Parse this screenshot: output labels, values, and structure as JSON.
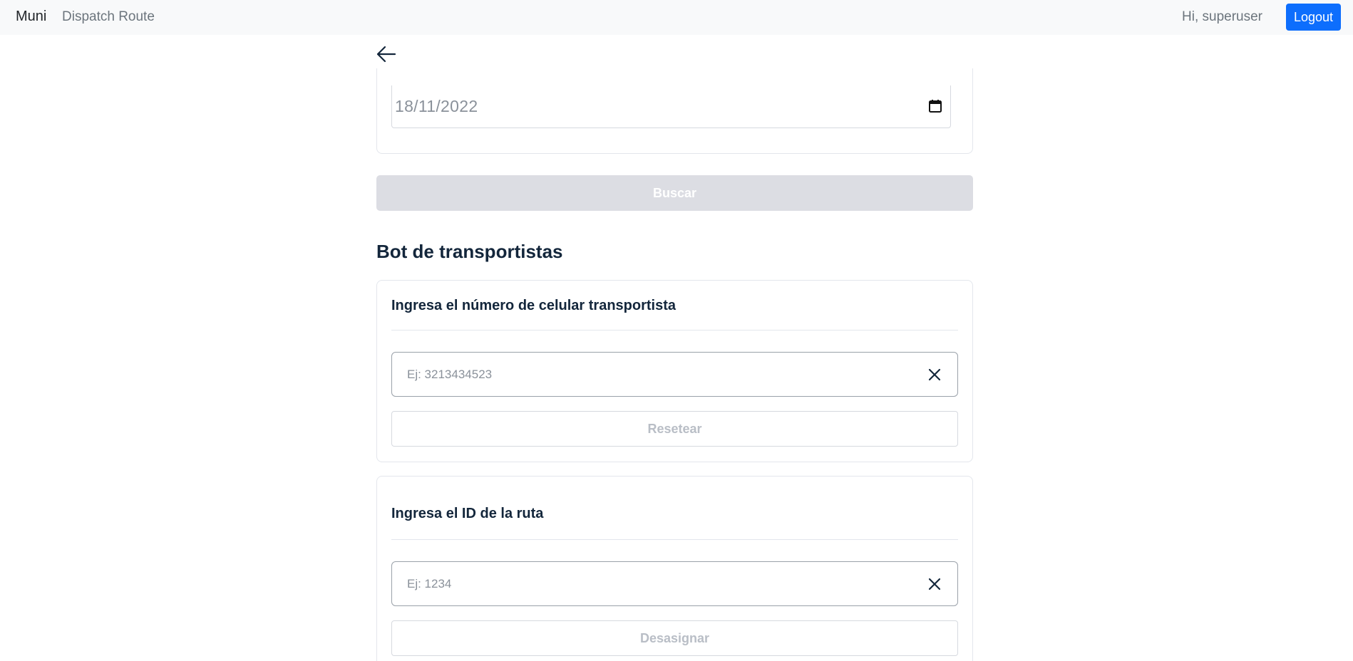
{
  "navbar": {
    "brand": "Muni",
    "link": "Dispatch Route",
    "greeting": "Hi, superuser",
    "logout_label": "Logout"
  },
  "back": {
    "icon": "arrow-left-icon"
  },
  "date_filter": {
    "value": "18/11/2022",
    "icon": "calendar-icon"
  },
  "search_button": {
    "label": "Buscar"
  },
  "bot_section": {
    "title": "Bot de transportistas",
    "phone_card": {
      "title": "Ingresa el número de celular transportista",
      "placeholder": "Ej: 3213434523",
      "button_label": "Resetear"
    },
    "route_card": {
      "title": "Ingresa el ID de la ruta",
      "placeholder": "Ej: 1234",
      "button_label": "Desasignar"
    }
  },
  "colors": {
    "primary": "#0d6efd",
    "title_text": "#13263b",
    "disabled_button_bg": "#dcdde3",
    "navbar_bg": "#f8f9fa"
  }
}
